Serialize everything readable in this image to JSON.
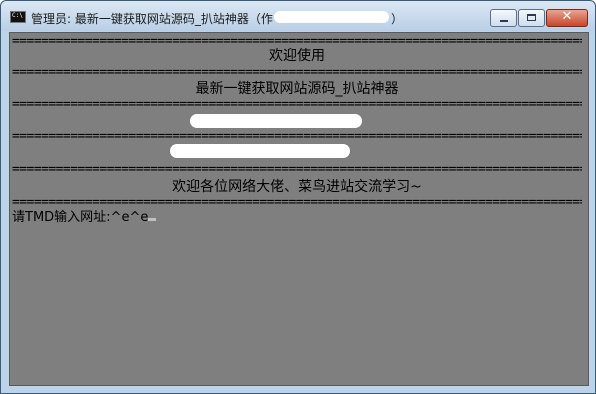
{
  "window": {
    "title": "管理员:  最新一键获取网站源码_扒站神器（作",
    "title_end": "）",
    "icon_text": "C:\\",
    "controls": {
      "minimize": "minimize",
      "maximize": "maximize",
      "close": "✕"
    }
  },
  "console": {
    "separator": "================================================================================",
    "welcome": "欢迎使用",
    "app_name": "最新一键获取网站源码_扒站神器",
    "greeting": "欢迎各位网络大佬、菜鸟进站交流学习~",
    "prompt": "请TMD输入网址:^e^e"
  },
  "colors": {
    "console_bg": "#7f7f7f",
    "console_text": "#000000",
    "title_bar": "#c8dcef",
    "close_button": "#c8452a"
  }
}
